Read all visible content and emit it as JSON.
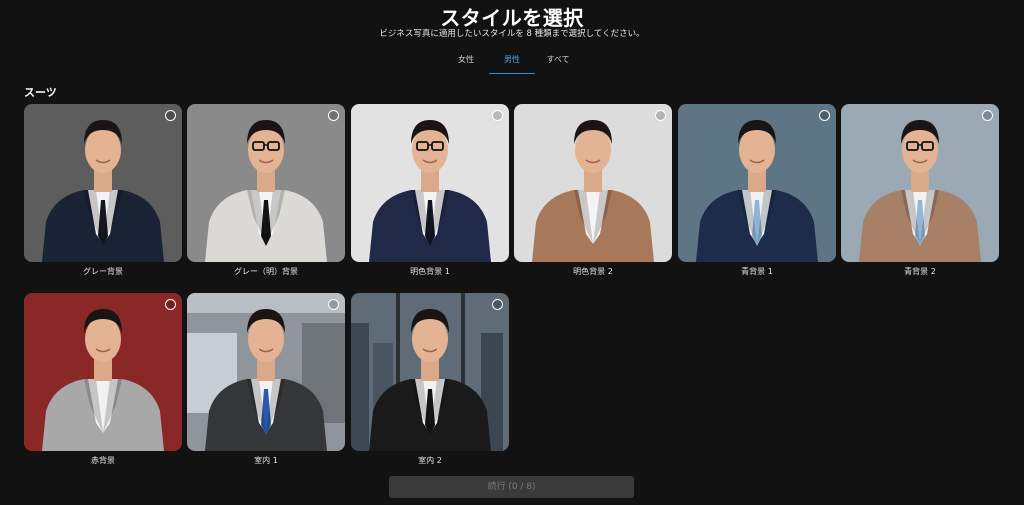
{
  "header": {
    "title": "スタイルを選択",
    "subtitle": "ビジネス写真に適用したいスタイルを 8 種類まで選択してください。"
  },
  "tabs": [
    {
      "label": "女性",
      "active": false
    },
    {
      "label": "男性",
      "active": true
    },
    {
      "label": "すべて",
      "active": false
    }
  ],
  "section": {
    "title": "スーツ"
  },
  "styles": [
    {
      "label": "グレー背景",
      "background": "#5d5d5d",
      "jacket": "#1a2236",
      "shirt": "#f2f2f2",
      "tie": "#151821",
      "glasses": false
    },
    {
      "label": "グレー（明）背景",
      "background": "#8a8a8a",
      "jacket": "#dcdad6",
      "shirt": "#f4f4f4",
      "tie": "#141414",
      "glasses": true
    },
    {
      "label": "明色背景 1",
      "background": "#e2e2e2",
      "jacket": "#202a48",
      "shirt": "#f4f4f4",
      "tie": "#121624",
      "glasses": true
    },
    {
      "label": "明色背景 2",
      "background": "#dcdcdc",
      "jacket": "#a8785a",
      "shirt": "#f4f4f4",
      "tie": "",
      "glasses": false
    },
    {
      "label": "青背景 1",
      "background": "#5d7585",
      "jacket": "#1e2c4c",
      "shirt": "#eef2f6",
      "tie": "#8fb2d6",
      "glasses": false
    },
    {
      "label": "青背景 2",
      "background": "#9aa9b3",
      "jacket": "#a88068",
      "shirt": "#f2f2f2",
      "tie": "#94b6d8",
      "glasses": true
    },
    {
      "label": "赤背景",
      "background": "#8a2828",
      "jacket": "#a8a8a8",
      "shirt": "#f2f2f2",
      "tie": "",
      "glasses": false
    },
    {
      "label": "室内 1",
      "background": "#8f959b",
      "jacket": "#343638",
      "shirt": "#f2f2f2",
      "tie": "#2c5aa8",
      "glasses": false
    },
    {
      "label": "室内 2",
      "background": "#5f6b76",
      "jacket": "#1a1a1a",
      "shirt": "#f2f2f2",
      "tie": "#141414",
      "glasses": false
    }
  ],
  "continue_button": {
    "label": "続行 (0 / 8)",
    "enabled": false
  },
  "colors": {
    "accent": "#2f8fd8",
    "background": "#121212"
  }
}
